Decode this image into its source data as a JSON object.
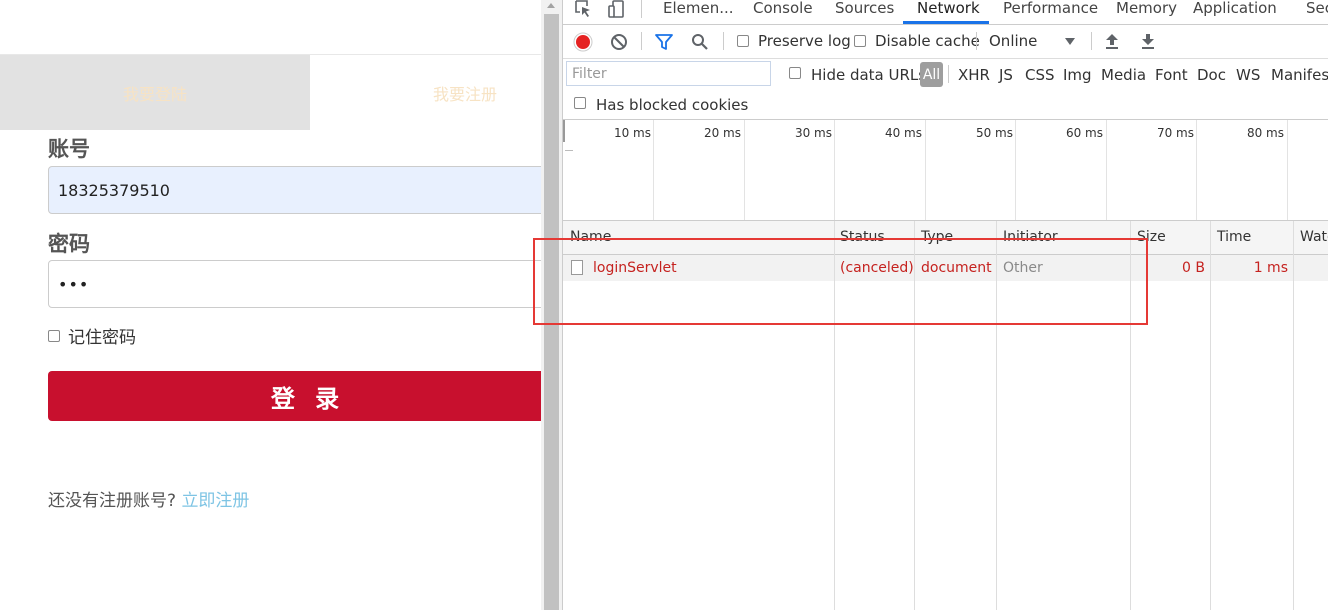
{
  "left_page": {
    "tabs": {
      "login": "我要登陆",
      "register": "我要注册"
    },
    "account_label": "账号",
    "account_value": "18325379510",
    "password_label": "密码",
    "password_value": "•••",
    "remember_label": "记住密码",
    "login_button": "登 录",
    "register_prompt": "还没有注册账号?",
    "register_link": "立即注册"
  },
  "devtools": {
    "tabs": [
      "Elemen...",
      "Console",
      "Sources",
      "Network",
      "Performance",
      "Memory",
      "Application",
      "Sec"
    ],
    "active_tab": "Network",
    "toolbar": {
      "preserve_log": "Preserve log",
      "disable_cache": "Disable cache",
      "throttle": "Online"
    },
    "filter": {
      "placeholder": "Filter",
      "hide_data_urls": "Hide data URLs",
      "types": [
        "All",
        "XHR",
        "JS",
        "CSS",
        "Img",
        "Media",
        "Font",
        "Doc",
        "WS",
        "Manifest"
      ],
      "has_blocked_cookies": "Has blocked cookies"
    },
    "timeline_ticks": [
      "10 ms",
      "20 ms",
      "30 ms",
      "40 ms",
      "50 ms",
      "60 ms",
      "70 ms",
      "80 ms"
    ],
    "columns": [
      "Name",
      "Status",
      "Type",
      "Initiator",
      "Size",
      "Time",
      "Wate"
    ],
    "requests": [
      {
        "name": "loginServlet",
        "status": "(canceled)",
        "type": "document",
        "initiator": "Other",
        "size": "0 B",
        "time": "1 ms"
      }
    ],
    "colors": {
      "record": "#e52222",
      "accent": "#1a73e8",
      "error_text": "#c5221f",
      "highlight_box": "#e53935"
    }
  }
}
